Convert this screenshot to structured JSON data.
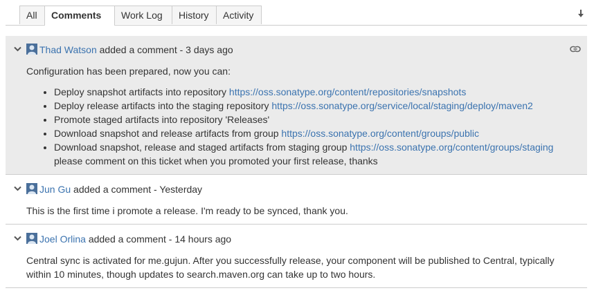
{
  "tabs": [
    {
      "label": "All"
    },
    {
      "label": "Comments"
    },
    {
      "label": "Work Log"
    },
    {
      "label": "History"
    },
    {
      "label": "Activity"
    }
  ],
  "comments": [
    {
      "author": "Thad Watson",
      "action": "added a comment",
      "sep": " - ",
      "time": "3 days ago",
      "intro": "Configuration has been prepared, now you can:",
      "items": [
        {
          "text": "Deploy snapshot artifacts into repository ",
          "link": "https://oss.sonatype.org/content/repositories/snapshots"
        },
        {
          "text": "Deploy release artifacts into the staging repository ",
          "link": "https://oss.sonatype.org/service/local/staging/deploy/maven2"
        },
        {
          "text": "Promote staged artifacts into repository 'Releases'"
        },
        {
          "text": "Download snapshot and release artifacts from group ",
          "link": "https://oss.sonatype.org/content/groups/public"
        },
        {
          "text": "Download snapshot, release and staged artifacts from staging group ",
          "link": "https://oss.sonatype.org/content/groups/staging",
          "tail": "please comment on this ticket when you promoted your first release, thanks"
        }
      ]
    },
    {
      "author": "Jun Gu",
      "action": "added a comment",
      "sep": " - ",
      "time": "Yesterday",
      "body": "This is the first time i promote a release. I'm ready to be synced, thank you."
    },
    {
      "author": "Joel Orlina",
      "action": "added a comment",
      "sep": " - ",
      "time": "14 hours ago",
      "body": "Central sync is activated for me.gujun. After you successfully release, your component will be published to Central, typically within 10 minutes, though updates to search.maven.org can take up to two hours."
    }
  ],
  "icons": {
    "sort": "arrow-down-icon",
    "collapse": "chevron-down-icon",
    "avatar": "user-avatar-icon",
    "permalink": "link-icon"
  },
  "colors": {
    "link": "#3b73af",
    "focused_bg": "#ebebeb",
    "border": "#cccccc",
    "text": "#333333"
  }
}
